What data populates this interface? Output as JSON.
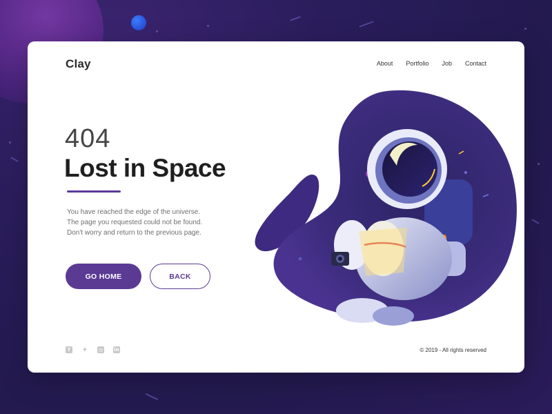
{
  "brand": {
    "name": "Clay"
  },
  "nav": {
    "items": [
      "About",
      "Portfolio",
      "Job",
      "Contact"
    ]
  },
  "hero": {
    "code": "404",
    "title": "Lost in Space",
    "description": [
      "You have reached the edge of the universe.",
      "The page you requested could not be found.",
      "Don't worry and return to the previous page."
    ],
    "primary_button": "GO HOME",
    "secondary_button": "BACK"
  },
  "footer": {
    "socials": [
      "facebook-icon",
      "twitter-icon",
      "instagram-icon",
      "linkedin-icon"
    ],
    "copyright": "© 2019 - All rights reserved"
  },
  "colors": {
    "accent": "#5b3a94",
    "background": "#2a1d5c",
    "card": "#ffffff",
    "blob": "#3b2a78"
  }
}
